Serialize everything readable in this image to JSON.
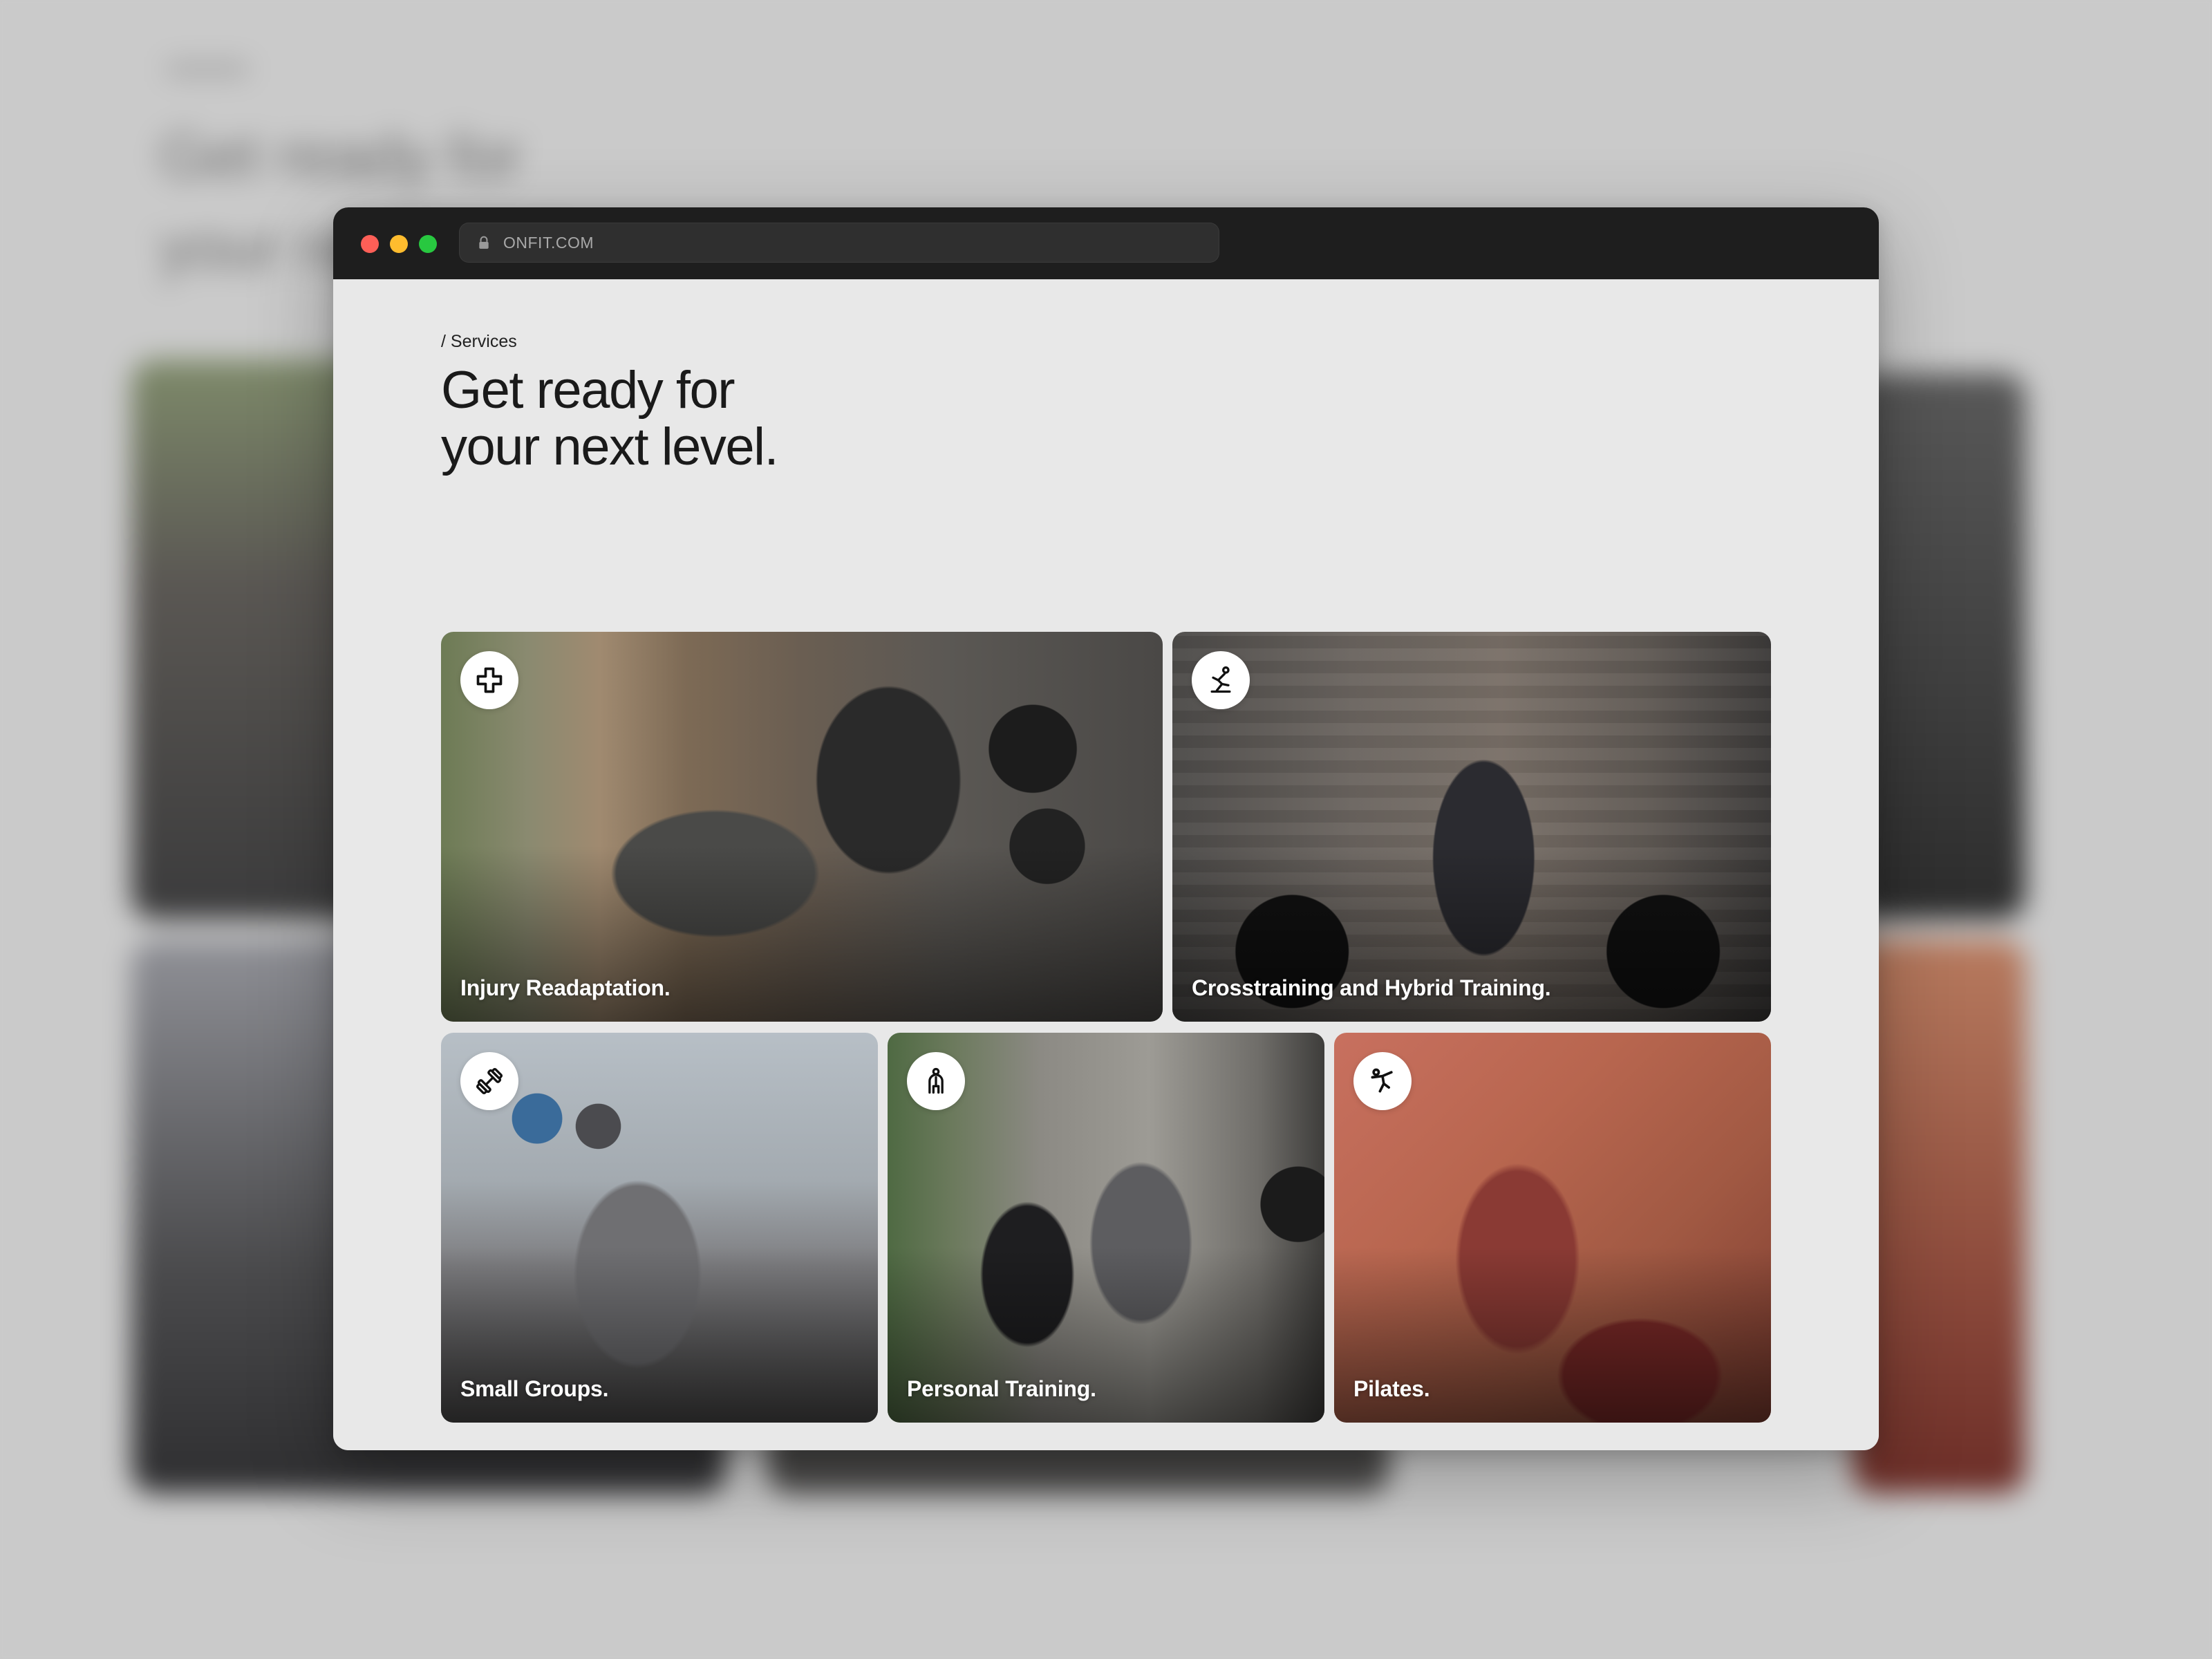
{
  "browser": {
    "url": "ONFIT.COM",
    "controls": [
      "close",
      "minimize",
      "zoom"
    ]
  },
  "page": {
    "breadcrumb": "/ Services",
    "title_line1": "Get ready for",
    "title_line2": "your next level."
  },
  "cards": [
    {
      "label": "Injury Readaptation.",
      "icon": "medical-cross-icon"
    },
    {
      "label": "Crosstraining and Hybrid Training.",
      "icon": "kettlebell-swing-icon"
    },
    {
      "label": "Small Groups.",
      "icon": "dumbbell-icon"
    },
    {
      "label": "Personal Training.",
      "icon": "trainer-person-icon"
    },
    {
      "label": "Pilates.",
      "icon": "kick-pose-icon"
    }
  ],
  "colors": {
    "page_bg": "#e8e8e8",
    "titlebar": "#1e1e1e",
    "dot_red": "#fe5f57",
    "dot_yellow": "#febc2e",
    "dot_green": "#28c840",
    "text_dark": "#1a1a1a",
    "label_text": "#ffffff"
  }
}
